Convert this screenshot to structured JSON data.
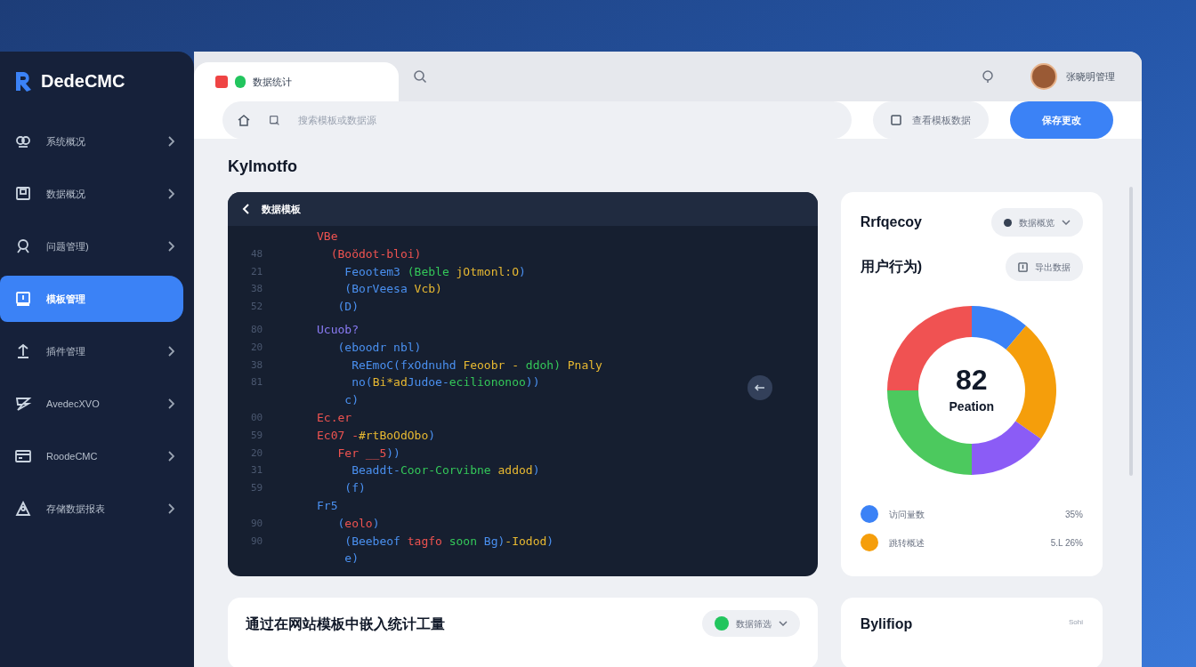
{
  "sidebar": {
    "logo": "DedeCMC",
    "items": [
      {
        "label": "系统概况",
        "selected": false
      },
      {
        "label": "数据概况",
        "selected": false
      },
      {
        "label": "问题管理)",
        "selected": false
      },
      {
        "label": "模板管理",
        "selected": true
      },
      {
        "label": "插件管理",
        "selected": false
      },
      {
        "label": "AvedecXVO",
        "selected": false
      },
      {
        "label": "RoodeCMC",
        "selected": false
      },
      {
        "label": "存储数据报表",
        "selected": false
      }
    ]
  },
  "topbar": {
    "tab": "数据统计",
    "user": "张晓明管理"
  },
  "toolbar": {
    "search": {
      "placeholder": "搜索模板或数据源"
    },
    "buttons": [
      "查看模板数据",
      "保存更改"
    ]
  },
  "page_title": "Kylmotfo",
  "code_panel": {
    "title": "数据模板",
    "lines": [
      {
        "tokens": [
          {
            "text": "VBe",
            "kind": "keyword"
          }
        ]
      },
      {
        "number": "48",
        "tokens": [
          {
            "text": "  (Boŏdot-bloi)",
            "kind": "keyword"
          }
        ]
      },
      {
        "number": "21",
        "tokens": [
          {
            "text": "    Feootem3 ",
            "kind": "func"
          },
          {
            "text": "(Beble ",
            "kind": "string"
          },
          {
            "text": "jOtmonl:O",
            "kind": "number"
          },
          {
            "text": ")",
            "kind": "func"
          }
        ]
      },
      {
        "number": "38",
        "tokens": [
          {
            "text": "    (BorVeesa ",
            "kind": "func"
          },
          {
            "text": "Vcb)",
            "kind": "number"
          }
        ]
      },
      {
        "number": "52",
        "tokens": [
          {
            "text": "   (D)",
            "kind": "func"
          }
        ]
      },
      {
        "number": "80",
        "tokens": [
          {
            "text": "Ucuob?",
            "kind": "type"
          }
        ]
      },
      {
        "number": "20",
        "tokens": [
          {
            "text": "   (eboodr nbl)",
            "kind": "func"
          }
        ]
      },
      {
        "number": "38",
        "tokens": [
          {
            "text": "     ReEmoC(fxOdnuhd ",
            "kind": "func"
          },
          {
            "text": "Feoobr - ",
            "kind": "number"
          },
          {
            "text": "ddoh)",
            "kind": "string"
          },
          {
            "text": " Pnaly",
            "kind": "number"
          }
        ]
      },
      {
        "number": "81",
        "tokens": [
          {
            "text": "     no(",
            "kind": "func"
          },
          {
            "text": "Bi*ad",
            "kind": "number"
          },
          {
            "text": "Judoe-",
            "kind": "func"
          },
          {
            "text": "eciliononoo",
            "kind": "string"
          },
          {
            "text": "))",
            "kind": "func"
          }
        ]
      },
      {
        "tokens": [
          {
            "text": "    c)",
            "kind": "func"
          }
        ]
      },
      {
        "number": "00",
        "tokens": [
          {
            "text": "Ec.er",
            "kind": "keyword"
          }
        ]
      },
      {
        "number": "59",
        "tokens": [
          {
            "text": "Ec07 -",
            "kind": "keyword"
          },
          {
            "text": "#rtBoOdObo",
            "kind": "number"
          },
          {
            "text": ")",
            "kind": "func"
          }
        ]
      },
      {
        "number": "20",
        "tokens": [
          {
            "text": "   Fer __5",
            "kind": "keyword"
          },
          {
            "text": "))",
            "kind": "func"
          }
        ]
      },
      {
        "number": "31",
        "tokens": [
          {
            "text": "     Beaddt-",
            "kind": "func"
          },
          {
            "text": "Coor-Corvibne ",
            "kind": "string"
          },
          {
            "text": "addod",
            "kind": "number"
          },
          {
            "text": ")",
            "kind": "func"
          }
        ]
      },
      {
        "number": "59",
        "tokens": [
          {
            "text": "    (f)",
            "kind": "func"
          }
        ]
      },
      {
        "tokens": [
          {
            "text": "Fr5",
            "kind": "func"
          }
        ]
      },
      {
        "number": "90",
        "tokens": [
          {
            "text": "   (",
            "kind": "func"
          },
          {
            "text": "eolo",
            "kind": "keyword"
          },
          {
            "text": ")",
            "kind": "func"
          }
        ]
      },
      {
        "number": "90",
        "tokens": [
          {
            "text": "    (Beebeof ",
            "kind": "func"
          },
          {
            "text": "tagfo ",
            "kind": "keyword"
          },
          {
            "text": "soon ",
            "kind": "string"
          },
          {
            "text": "Bg)",
            "kind": "func"
          },
          {
            "text": "-Iodod",
            "kind": "number"
          },
          {
            "text": ")",
            "kind": "func"
          }
        ]
      },
      {
        "tokens": [
          {
            "text": "    e)",
            "kind": "func"
          }
        ]
      }
    ]
  },
  "stats_card": {
    "title": "Rrfqecoy",
    "dropdown": "数据概览",
    "subtitle": "用户行为)",
    "export_button": "导出数据",
    "center_value": "82",
    "center_label": "Peation",
    "legend": [
      {
        "label": "访问量数",
        "value": "35%",
        "color": "#3b82f6"
      },
      {
        "label": "跳转概述",
        "value": "5.L 26%",
        "color": "#f59e0b"
      }
    ]
  },
  "bottom_left_card": {
    "title": "通过在网站模板中嵌入统计工量",
    "filter": "数据筛选"
  },
  "bottom_right_card": {
    "title": "Bylifiop",
    "note": "Sohi"
  }
}
